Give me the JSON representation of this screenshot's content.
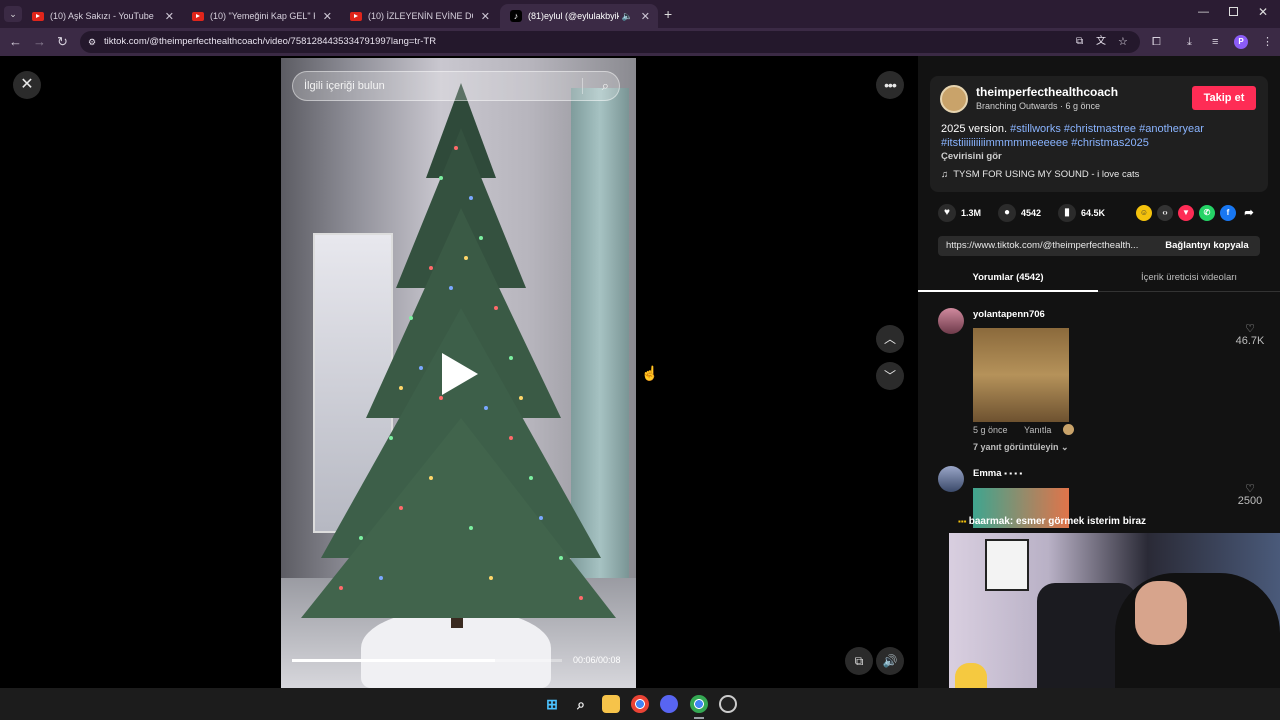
{
  "browser": {
    "tabs": [
      {
        "title": "(10) Aşk Sakızı - YouTube",
        "active": false
      },
      {
        "title": "(10) \"Yemeğini Kap GEL\" Kick &",
        "active": false
      },
      {
        "title": "(10) İZLEYENİN EVİNE DÖŞEYEN",
        "active": false
      },
      {
        "title": "(81)eylul (@eylulakbyik) | T",
        "active": true
      }
    ],
    "url": "tiktok.com/@theimperfecthealthcoach/video/7581284435334791997lang=tr-TR",
    "profile_initial": "P"
  },
  "video": {
    "search_placeholder": "İlgili içeriği bulun",
    "time": "00:06/00:08",
    "progress": 0.75
  },
  "post": {
    "username": "theimperfecthealthcoach",
    "subtitle": "Branching Outwards · 6 g önce",
    "follow_label": "Takip et",
    "description_plain": "2025 version. ",
    "hashtags": [
      "#stillworks",
      "#christmastree",
      "#anotheryear",
      "#itstiiiiiiiiiimmmmmeeeeee",
      "#christmas2025"
    ],
    "translate_label": "Çevirisini gör",
    "music_label": "TYSM FOR USING MY SOUND - i love cats",
    "likes": "1.3M",
    "comments": "4542",
    "saves": "64.5K",
    "link": "https://www.tiktok.com/@theimperfecthealth...",
    "copy_label": "Bağlantıyı kopyala"
  },
  "tabs": {
    "comments": "Yorumlar (4542)",
    "creator_videos": "İçerik üreticisi videoları"
  },
  "comments": [
    {
      "user": "yolantapenn706",
      "likes": "46.7K",
      "time": "5 g önce",
      "reply_label": "Yanıtla",
      "view_replies": "7 yanıt görüntüleyin"
    },
    {
      "user": "Emma",
      "likes": "2500"
    }
  ],
  "overlay_comment": "baarmak: esmer görmek isterim biraz"
}
